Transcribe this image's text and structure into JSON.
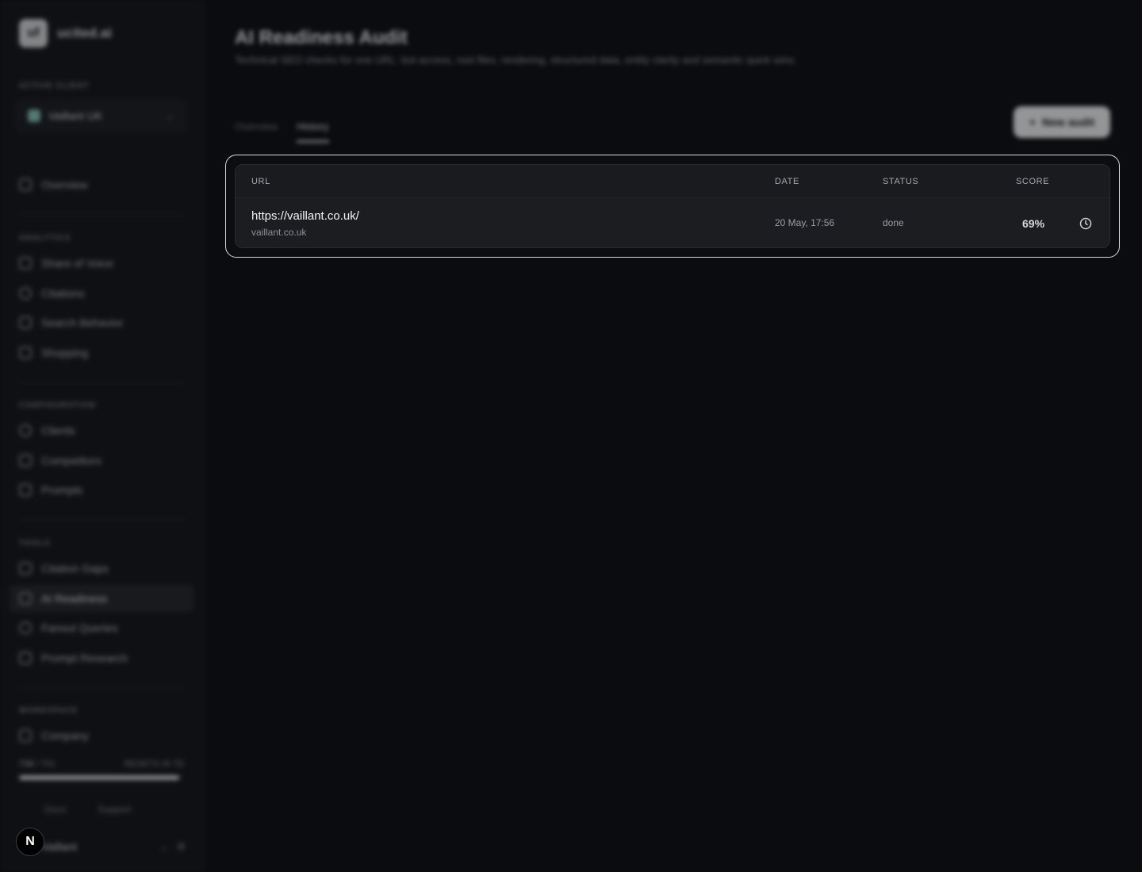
{
  "brand": {
    "logo_text": "uf",
    "name": "ucited.ai"
  },
  "sidebar": {
    "active_client_label": "ACTIVE CLIENT",
    "client_name": "Vaillant UK",
    "overview": "Overview",
    "sections": [
      {
        "label": "ANALYTICS",
        "items": [
          "Share of Voice",
          "Citations",
          "Search Behavior",
          "Shopping"
        ]
      },
      {
        "label": "CONFIGURATION",
        "items": [
          "Clients",
          "Competitors",
          "Prompts"
        ]
      },
      {
        "label": "TOOLS",
        "items": [
          "Citation Gaps",
          "AI Readiness",
          "Fanout Queries",
          "Prompt Research"
        ]
      },
      {
        "label": "WORKSPACE",
        "items": [
          "Company"
        ]
      }
    ],
    "usage": {
      "used": "738",
      "total": "/ 751",
      "note": "RESETS IN 7D",
      "fraction": 0.98
    },
    "footer": {
      "docs": "Docs",
      "support": "Support"
    },
    "user": {
      "name": "Vaillant"
    }
  },
  "header": {
    "title": "AI Readiness Audit",
    "subtitle": "Technical SEO checks for one URL: bot access, root files, rendering, structured data, entity clarity and semantic quick wins."
  },
  "tabs": [
    {
      "label": "Overview",
      "active": false
    },
    {
      "label": "History",
      "active": true
    }
  ],
  "new_audit_label": "New audit",
  "history_table": {
    "columns": [
      "URL",
      "DATE",
      "STATUS",
      "SCORE"
    ],
    "rows": [
      {
        "url": "https://vaillant.co.uk/",
        "host": "vaillant.co.uk",
        "date": "20 May, 17:56",
        "status": "done",
        "score": "69%"
      }
    ]
  },
  "dev_badge": "N",
  "icons": {
    "row_action": "clock-icon"
  }
}
